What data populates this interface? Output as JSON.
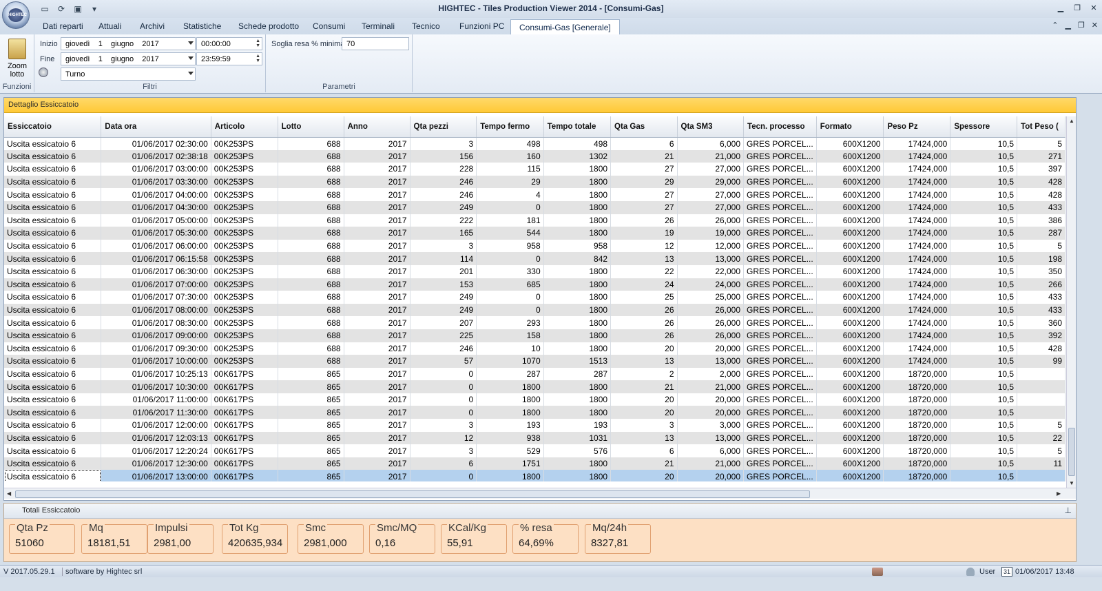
{
  "window": {
    "title": "HIGHTEC - Tiles Production Viewer 2014 - [Consumi-Gas]",
    "logo_text": "HIGHTEC"
  },
  "tabs": [
    "Dati reparti",
    "Attuali",
    "Archivi",
    "Statistiche",
    "Schede prodotto",
    "Consumi",
    "Terminali",
    "Tecnico",
    "Funzioni PC",
    "Consumi-Gas [Generale]"
  ],
  "ribbon": {
    "zoom_label": "Zoom lotto",
    "funzioni_label": "Funzioni",
    "filtri_label": "Filtri",
    "parametri_label": "Parametri",
    "inizio_label": "Inizio",
    "fine_label": "Fine",
    "inizio_date": "giovedì    1    giugno    2017",
    "inizio_time": "00:00:00",
    "fine_date": "giovedì    1    giugno    2017",
    "fine_time": "23:59:59",
    "turno": "Turno",
    "soglia_label": "Soglia resa % minima",
    "soglia_value": "70"
  },
  "grid": {
    "caption": "Dettaglio Essiccatoio",
    "columns": [
      "Essiccatoio",
      "Data ora",
      "Articolo",
      "Lotto",
      "Anno",
      "Qta pezzi",
      "Tempo fermo",
      "Tempo totale",
      "Qta Gas",
      "Qta SM3",
      "Tecn. processo",
      "Formato",
      "Peso Pz",
      "Spessore",
      "Tot Peso ("
    ],
    "rows": [
      [
        "Uscita essicatoio  6",
        "01/06/2017 02:30:00",
        "00K253PS",
        "688",
        "2017",
        "3",
        "498",
        "498",
        "6",
        "6,000",
        "GRES PORCEL...",
        "600X1200",
        "17424,000",
        "10,5",
        "5"
      ],
      [
        "Uscita essicatoio  6",
        "01/06/2017 02:38:18",
        "00K253PS",
        "688",
        "2017",
        "156",
        "160",
        "1302",
        "21",
        "21,000",
        "GRES PORCEL...",
        "600X1200",
        "17424,000",
        "10,5",
        "271"
      ],
      [
        "Uscita essicatoio  6",
        "01/06/2017 03:00:00",
        "00K253PS",
        "688",
        "2017",
        "228",
        "115",
        "1800",
        "27",
        "27,000",
        "GRES PORCEL...",
        "600X1200",
        "17424,000",
        "10,5",
        "397"
      ],
      [
        "Uscita essicatoio  6",
        "01/06/2017 03:30:00",
        "00K253PS",
        "688",
        "2017",
        "246",
        "29",
        "1800",
        "29",
        "29,000",
        "GRES PORCEL...",
        "600X1200",
        "17424,000",
        "10,5",
        "428"
      ],
      [
        "Uscita essicatoio  6",
        "01/06/2017 04:00:00",
        "00K253PS",
        "688",
        "2017",
        "246",
        "4",
        "1800",
        "27",
        "27,000",
        "GRES PORCEL...",
        "600X1200",
        "17424,000",
        "10,5",
        "428"
      ],
      [
        "Uscita essicatoio  6",
        "01/06/2017 04:30:00",
        "00K253PS",
        "688",
        "2017",
        "249",
        "0",
        "1800",
        "27",
        "27,000",
        "GRES PORCEL...",
        "600X1200",
        "17424,000",
        "10,5",
        "433"
      ],
      [
        "Uscita essicatoio  6",
        "01/06/2017 05:00:00",
        "00K253PS",
        "688",
        "2017",
        "222",
        "181",
        "1800",
        "26",
        "26,000",
        "GRES PORCEL...",
        "600X1200",
        "17424,000",
        "10,5",
        "386"
      ],
      [
        "Uscita essicatoio  6",
        "01/06/2017 05:30:00",
        "00K253PS",
        "688",
        "2017",
        "165",
        "544",
        "1800",
        "19",
        "19,000",
        "GRES PORCEL...",
        "600X1200",
        "17424,000",
        "10,5",
        "287"
      ],
      [
        "Uscita essicatoio  6",
        "01/06/2017 06:00:00",
        "00K253PS",
        "688",
        "2017",
        "3",
        "958",
        "958",
        "12",
        "12,000",
        "GRES PORCEL...",
        "600X1200",
        "17424,000",
        "10,5",
        "5"
      ],
      [
        "Uscita essicatoio  6",
        "01/06/2017 06:15:58",
        "00K253PS",
        "688",
        "2017",
        "114",
        "0",
        "842",
        "13",
        "13,000",
        "GRES PORCEL...",
        "600X1200",
        "17424,000",
        "10,5",
        "198"
      ],
      [
        "Uscita essicatoio  6",
        "01/06/2017 06:30:00",
        "00K253PS",
        "688",
        "2017",
        "201",
        "330",
        "1800",
        "22",
        "22,000",
        "GRES PORCEL...",
        "600X1200",
        "17424,000",
        "10,5",
        "350"
      ],
      [
        "Uscita essicatoio  6",
        "01/06/2017 07:00:00",
        "00K253PS",
        "688",
        "2017",
        "153",
        "685",
        "1800",
        "24",
        "24,000",
        "GRES PORCEL...",
        "600X1200",
        "17424,000",
        "10,5",
        "266"
      ],
      [
        "Uscita essicatoio  6",
        "01/06/2017 07:30:00",
        "00K253PS",
        "688",
        "2017",
        "249",
        "0",
        "1800",
        "25",
        "25,000",
        "GRES PORCEL...",
        "600X1200",
        "17424,000",
        "10,5",
        "433"
      ],
      [
        "Uscita essicatoio  6",
        "01/06/2017 08:00:00",
        "00K253PS",
        "688",
        "2017",
        "249",
        "0",
        "1800",
        "26",
        "26,000",
        "GRES PORCEL...",
        "600X1200",
        "17424,000",
        "10,5",
        "433"
      ],
      [
        "Uscita essicatoio  6",
        "01/06/2017 08:30:00",
        "00K253PS",
        "688",
        "2017",
        "207",
        "293",
        "1800",
        "26",
        "26,000",
        "GRES PORCEL...",
        "600X1200",
        "17424,000",
        "10,5",
        "360"
      ],
      [
        "Uscita essicatoio  6",
        "01/06/2017 09:00:00",
        "00K253PS",
        "688",
        "2017",
        "225",
        "158",
        "1800",
        "26",
        "26,000",
        "GRES PORCEL...",
        "600X1200",
        "17424,000",
        "10,5",
        "392"
      ],
      [
        "Uscita essicatoio  6",
        "01/06/2017 09:30:00",
        "00K253PS",
        "688",
        "2017",
        "246",
        "10",
        "1800",
        "20",
        "20,000",
        "GRES PORCEL...",
        "600X1200",
        "17424,000",
        "10,5",
        "428"
      ],
      [
        "Uscita essicatoio  6",
        "01/06/2017 10:00:00",
        "00K253PS",
        "688",
        "2017",
        "57",
        "1070",
        "1513",
        "13",
        "13,000",
        "GRES PORCEL...",
        "600X1200",
        "17424,000",
        "10,5",
        "99"
      ],
      [
        "Uscita essicatoio  6",
        "01/06/2017 10:25:13",
        "00K617PS",
        "865",
        "2017",
        "0",
        "287",
        "287",
        "2",
        "2,000",
        "GRES PORCEL...",
        "600X1200",
        "18720,000",
        "10,5",
        ""
      ],
      [
        "Uscita essicatoio  6",
        "01/06/2017 10:30:00",
        "00K617PS",
        "865",
        "2017",
        "0",
        "1800",
        "1800",
        "21",
        "21,000",
        "GRES PORCEL...",
        "600X1200",
        "18720,000",
        "10,5",
        ""
      ],
      [
        "Uscita essicatoio  6",
        "01/06/2017 11:00:00",
        "00K617PS",
        "865",
        "2017",
        "0",
        "1800",
        "1800",
        "20",
        "20,000",
        "GRES PORCEL...",
        "600X1200",
        "18720,000",
        "10,5",
        ""
      ],
      [
        "Uscita essicatoio  6",
        "01/06/2017 11:30:00",
        "00K617PS",
        "865",
        "2017",
        "0",
        "1800",
        "1800",
        "20",
        "20,000",
        "GRES PORCEL...",
        "600X1200",
        "18720,000",
        "10,5",
        ""
      ],
      [
        "Uscita essicatoio  6",
        "01/06/2017 12:00:00",
        "00K617PS",
        "865",
        "2017",
        "3",
        "193",
        "193",
        "3",
        "3,000",
        "GRES PORCEL...",
        "600X1200",
        "18720,000",
        "10,5",
        "5"
      ],
      [
        "Uscita essicatoio  6",
        "01/06/2017 12:03:13",
        "00K617PS",
        "865",
        "2017",
        "12",
        "938",
        "1031",
        "13",
        "13,000",
        "GRES PORCEL...",
        "600X1200",
        "18720,000",
        "10,5",
        "22"
      ],
      [
        "Uscita essicatoio  6",
        "01/06/2017 12:20:24",
        "00K617PS",
        "865",
        "2017",
        "3",
        "529",
        "576",
        "6",
        "6,000",
        "GRES PORCEL...",
        "600X1200",
        "18720,000",
        "10,5",
        "5"
      ],
      [
        "Uscita essicatoio  6",
        "01/06/2017 12:30:00",
        "00K617PS",
        "865",
        "2017",
        "6",
        "1751",
        "1800",
        "21",
        "21,000",
        "GRES PORCEL...",
        "600X1200",
        "18720,000",
        "10,5",
        "11"
      ],
      [
        "Uscita essicatoio  6",
        "01/06/2017 13:00:00",
        "00K617PS",
        "865",
        "2017",
        "0",
        "1800",
        "1800",
        "20",
        "20,000",
        "GRES PORCEL...",
        "600X1200",
        "18720,000",
        "10,5",
        ""
      ]
    ]
  },
  "totals": {
    "caption": "Totali Essiccatoio",
    "items": [
      {
        "label": "Qta Pz",
        "value": "51060"
      },
      {
        "label": "Mq",
        "value": "18181,51"
      },
      {
        "label": "Impulsi",
        "value": "2981,00"
      },
      {
        "label": "Tot Kg",
        "value": "420635,934"
      },
      {
        "label": "Smc",
        "value": "2981,000"
      },
      {
        "label": "Smc/MQ",
        "value": "0,16"
      },
      {
        "label": "KCal/Kg",
        "value": "55,91"
      },
      {
        "label": "% resa",
        "value": "64,69%"
      },
      {
        "label": "Mq/24h",
        "value": "8327,81"
      }
    ]
  },
  "status": {
    "version": "V 2017.05.29.1",
    "credit": "software by Hightec srl",
    "user": "User",
    "calendar_day": "31",
    "datetime": "01/06/2017 13:48"
  }
}
